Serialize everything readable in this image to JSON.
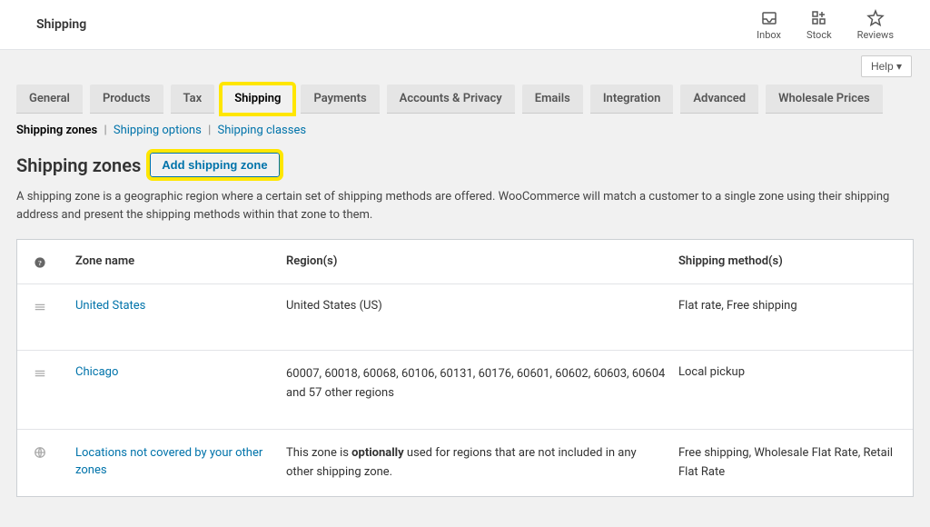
{
  "topbar": {
    "title": "Shipping",
    "icons": [
      {
        "label": "Inbox"
      },
      {
        "label": "Stock"
      },
      {
        "label": "Reviews"
      }
    ]
  },
  "help_label": "Help ▾",
  "tabs": [
    {
      "label": "General"
    },
    {
      "label": "Products"
    },
    {
      "label": "Tax"
    },
    {
      "label": "Shipping"
    },
    {
      "label": "Payments"
    },
    {
      "label": "Accounts & Privacy"
    },
    {
      "label": "Emails"
    },
    {
      "label": "Integration"
    },
    {
      "label": "Advanced"
    },
    {
      "label": "Wholesale Prices"
    }
  ],
  "subnav": {
    "zones": "Shipping zones",
    "options": "Shipping options",
    "classes": "Shipping classes"
  },
  "heading": "Shipping zones",
  "add_button": "Add shipping zone",
  "description": "A shipping zone is a geographic region where a certain set of shipping methods are offered. WooCommerce will match a customer to a single zone using their shipping address and present the shipping methods within that zone to them.",
  "columns": {
    "zone": "Zone name",
    "region": "Region(s)",
    "methods": "Shipping method(s)"
  },
  "zones": [
    {
      "name": "United States",
      "regions": "United States (US)",
      "methods": "Flat rate, Free shipping",
      "draggable": true
    },
    {
      "name": "Chicago",
      "regions": "60007, 60018, 60068, 60106, 60131, 60176, 60601, 60602, 60603, 60604 and 57 other regions",
      "methods": "Local pickup",
      "draggable": true
    },
    {
      "name": "Locations not covered by your other zones",
      "regions_prefix": "This zone is ",
      "regions_bold": "optionally",
      "regions_suffix": " used for regions that are not included in any other shipping zone.",
      "methods": "Free shipping, Wholesale Flat Rate, Retail Flat Rate",
      "draggable": false
    }
  ]
}
